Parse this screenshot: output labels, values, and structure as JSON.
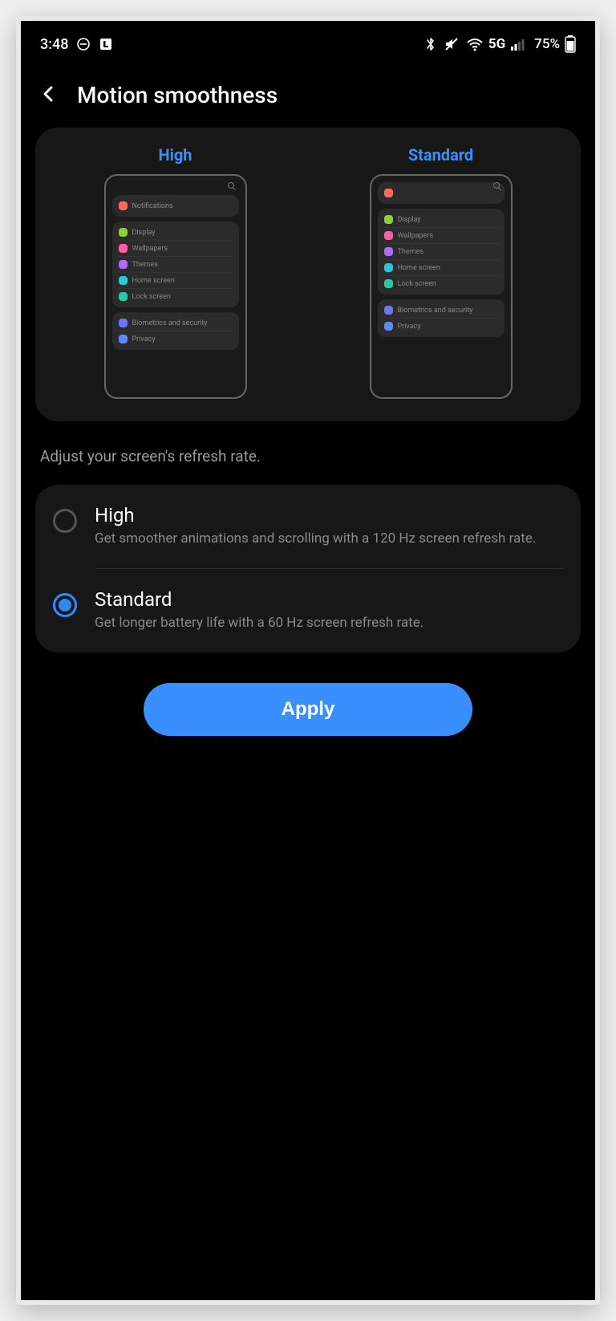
{
  "status": {
    "time": "3:48",
    "network": "5G",
    "battery": "75%"
  },
  "header": {
    "title": "Motion smoothness"
  },
  "preview": {
    "high_label": "High",
    "standard_label": "Standard",
    "mini_items": {
      "notifications": "Notifications",
      "display": "Display",
      "wallpapers": "Wallpapers",
      "themes": "Themes",
      "home_screen": "Home screen",
      "lock_screen": "Lock screen",
      "biometrics": "Biometrics and security",
      "privacy": "Privacy"
    },
    "icon_colors": {
      "notifications": "#ff6b5b",
      "display": "#8bd13a",
      "wallpapers": "#ff5fa8",
      "themes": "#b569ff",
      "home_screen": "#2ac8d6",
      "lock_screen": "#2ac8a9",
      "biometrics": "#6a76ff",
      "privacy": "#5b8bff"
    }
  },
  "description": "Adjust your screen's refresh rate.",
  "options": {
    "high": {
      "title": "High",
      "subtitle": "Get smoother animations and scrolling with a 120 Hz screen refresh rate.",
      "selected": false
    },
    "standard": {
      "title": "Standard",
      "subtitle": "Get longer battery life with a 60 Hz screen refresh rate.",
      "selected": true
    }
  },
  "apply_label": "Apply"
}
